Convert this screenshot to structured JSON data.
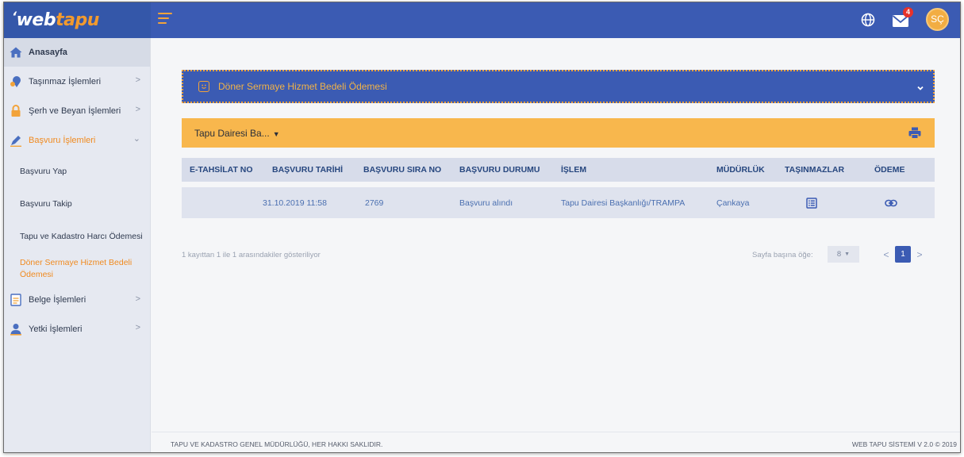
{
  "app": {
    "logo_web": "web",
    "logo_tapu": "tapu"
  },
  "header": {
    "mail_count": "4",
    "avatar_initials": "SÇ",
    "icons": [
      "menu-icon",
      "globe-icon",
      "mail-icon"
    ]
  },
  "sidebar": {
    "home": "Anasayfa",
    "items": [
      {
        "label": "Taşınmaz İşlemleri",
        "icon": "house-pin-icon"
      },
      {
        "label": "Şerh ve Beyan İşlemleri",
        "icon": "lock-icon"
      },
      {
        "label": "Başvuru İşlemleri",
        "icon": "pen-icon"
      },
      {
        "label": "Belge İşlemleri",
        "icon": "document-icon"
      },
      {
        "label": "Yetki İşlemleri",
        "icon": "user-icon"
      }
    ],
    "sub_items": [
      "Başvuru Yap",
      "Başvuru Takip",
      "Tapu ve Kadastro Harcı Ödemesi",
      "Döner Sermaye Hizmet Bedeli",
      "Ödemesi"
    ]
  },
  "service_bar": {
    "title": "Döner Sermaye Hizmet Bedeli Ödemesi"
  },
  "filter": {
    "department": "Tapu Dairesi Ba..."
  },
  "table": {
    "columns": [
      "E-TAHSİLAT NO",
      "BAŞVURU TARİHİ",
      "BAŞVURU SIRA NO",
      "BAŞVURU DURUMU",
      "İŞLEM",
      "MÜDÜRLÜK",
      "TAŞINMAZLAR",
      "ÖDEME"
    ],
    "rows": [
      {
        "e_tahsilat_no": "",
        "basvuru_tarihi": "31.10.2019 11:58",
        "basvuru_sira_no": "2769",
        "basvuru_durumu": "Başvuru alındı",
        "islem": "Tapu Dairesi Başkanlığı/TRAMPA",
        "mudurluk": "Çankaya"
      }
    ]
  },
  "pagination": {
    "info": "1 kayıttan 1 ile 1 arasındakiler gösteriliyor",
    "per_page_label": "Sayfa başına öğe:",
    "per_page_value": "8",
    "current_page": "1"
  },
  "footer": {
    "left": "TAPU VE KADASTRO GENEL MÜDÜRLÜĞÜ, HER HAKKI SAKLIDIR.",
    "right": "WEB TAPU SİSTEMİ V 2.0 © 2019"
  },
  "colors": {
    "primary": "#3b5bb3",
    "accent": "#f2a33a",
    "filter_bar": "#f8b74d",
    "active_text": "#f08a1f"
  }
}
